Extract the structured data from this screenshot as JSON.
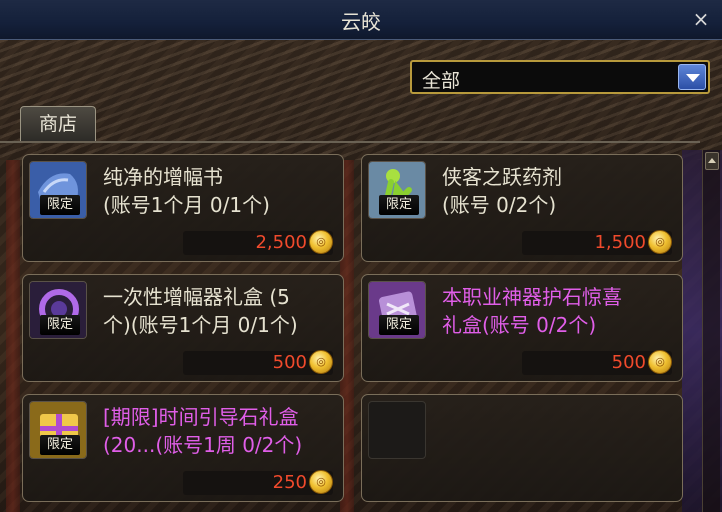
{
  "window": {
    "title": "云皎",
    "close_label": "×"
  },
  "filter": {
    "selected": "全部"
  },
  "tabs": [
    {
      "label": "商店"
    }
  ],
  "colors": {
    "name_normal": "#e6e2d0",
    "name_rare": "#e05ee8",
    "price": "#f04a2c"
  },
  "items": [
    {
      "name": "纯净的增幅书\n(账号1个月 0/1个)",
      "badge": "限定",
      "price": "2,500",
      "name_color": "white",
      "icon": "book-icon"
    },
    {
      "name": "侠客之跃药剂\n(账号 0/2个)",
      "badge": "限定",
      "price": "1,500",
      "name_color": "white",
      "icon": "potion-icon"
    },
    {
      "name": "一次性增幅器礼盒 (5\n个)(账号1个月 0/1个)",
      "badge": "限定",
      "price": "500",
      "name_color": "white",
      "icon": "ring-box-icon"
    },
    {
      "name": "本职业神器护石惊喜\n礼盒(账号 0/2个)",
      "badge": "限定",
      "price": "500",
      "name_color": "pink",
      "icon": "gem-box-icon"
    },
    {
      "name": "[期限]时间引导石礼盒\n(20...(账号1周 0/2个)",
      "badge": "限定",
      "price": "250",
      "name_color": "pink",
      "icon": "gift-box-icon"
    }
  ]
}
